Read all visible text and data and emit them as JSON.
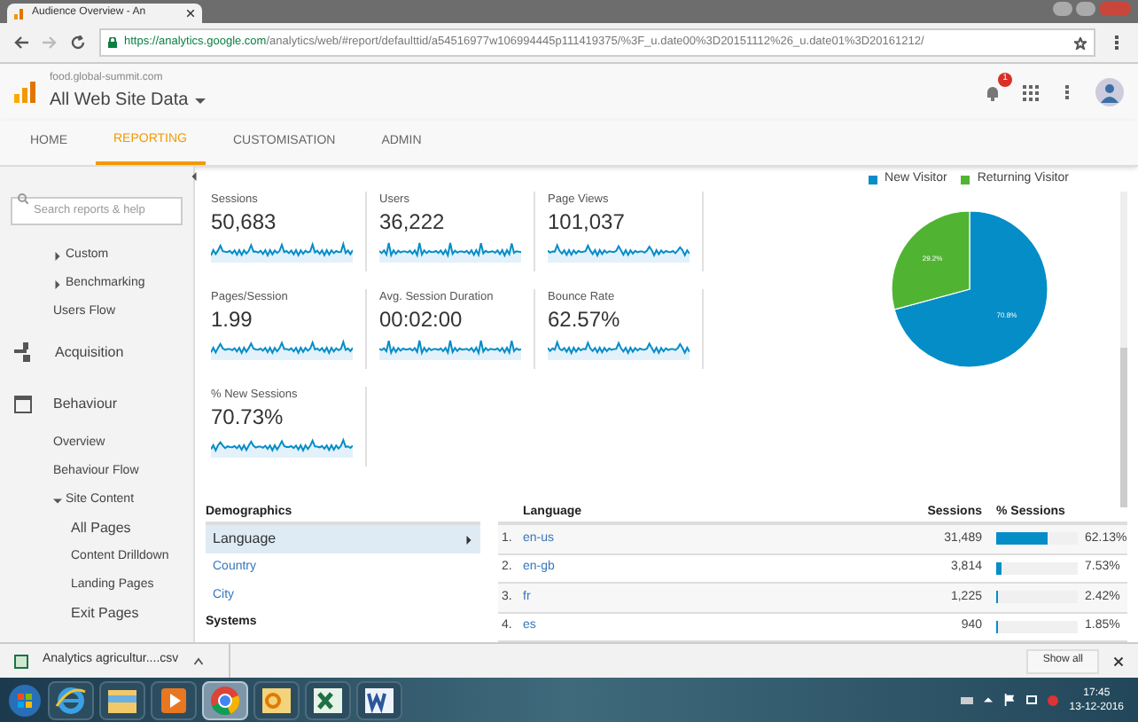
{
  "browser": {
    "tab_title": "Audience Overview - An",
    "url_host": "https://analytics.google.com",
    "url_path": "/analytics/web/#report/defaulttid/a54516977w106994445p111419375/%3F_u.date00%3D20151112%26_u.date01%3D20161212/"
  },
  "header": {
    "account": "food.global-summit.com",
    "property": "All Web Site Data",
    "notifications": "1"
  },
  "nav_tabs": [
    {
      "label": "HOME",
      "selected": false
    },
    {
      "label": "REPORTING",
      "selected": true
    },
    {
      "label": "CUSTOMISATION",
      "selected": false
    },
    {
      "label": "ADMIN",
      "selected": false
    }
  ],
  "sidebar": {
    "search_placeholder": "Search reports & help",
    "items": [
      {
        "label": "Custom",
        "kind": "collapsed"
      },
      {
        "label": "Benchmarking",
        "kind": "collapsed"
      },
      {
        "label": "Users Flow",
        "kind": "link"
      },
      {
        "label": "Acquisition",
        "kind": "section"
      },
      {
        "label": "Behaviour",
        "kind": "section",
        "children": [
          {
            "label": "Overview",
            "kind": "link"
          },
          {
            "label": "Behaviour Flow",
            "kind": "link"
          },
          {
            "label": "Site Content",
            "kind": "expanded",
            "children": [
              {
                "label": "All Pages",
                "kind": "link"
              },
              {
                "label": "Content Drilldown",
                "kind": "link"
              },
              {
                "label": "Landing Pages",
                "kind": "link"
              },
              {
                "label": "Exit Pages",
                "kind": "link"
              }
            ]
          }
        ]
      }
    ]
  },
  "scorecards": [
    {
      "label": "Sessions",
      "value": "50,683"
    },
    {
      "label": "Users",
      "value": "36,222"
    },
    {
      "label": "Page Views",
      "value": "101,037"
    },
    {
      "label": "Pages/Session",
      "value": "1.99"
    },
    {
      "label": "Avg. Session Duration",
      "value": "00:02:00"
    },
    {
      "label": "Bounce Rate",
      "value": "62.57%"
    },
    {
      "label": "% New Sessions",
      "value": "70.73%"
    }
  ],
  "visitor_chart": {
    "chart_data": {
      "type": "pie",
      "legend": true,
      "categories": [
        "New Visitor",
        "Returning Visitor"
      ],
      "values": [
        70.8,
        29.2
      ],
      "colors": [
        "#058dc7",
        "#50b432"
      ],
      "value_labels": [
        "70.8%",
        "29.2%"
      ]
    }
  },
  "demographics": {
    "title": "Demographics",
    "items": [
      {
        "label": "Language",
        "selected": true
      },
      {
        "label": "Country",
        "selected": false
      },
      {
        "label": "City",
        "selected": false
      }
    ],
    "next_title": "Systems"
  },
  "language_table": {
    "columns": [
      "Language",
      "Sessions",
      "% Sessions"
    ],
    "rows": [
      {
        "rank": "1.",
        "language": "en-us",
        "sessions": "31,489",
        "percent": "62.13%",
        "level": 0.6213
      },
      {
        "rank": "2.",
        "language": "en-gb",
        "sessions": "3,814",
        "percent": "7.53%",
        "level": 0.0753
      },
      {
        "rank": "3.",
        "language": "fr",
        "sessions": "1,225",
        "percent": "2.42%",
        "level": 0.0242
      },
      {
        "rank": "4.",
        "language": "es",
        "sessions": "940",
        "percent": "1.85%",
        "level": 0.0185
      }
    ]
  },
  "download_bar": {
    "file": "Analytics agricultur....csv",
    "button": "Show all"
  },
  "taskbar": {
    "apps": [
      {
        "kind": "ie",
        "selected": false
      },
      {
        "kind": "folder",
        "selected": false
      },
      {
        "kind": "media",
        "selected": false
      },
      {
        "kind": "chrome",
        "selected": true
      },
      {
        "kind": "outlook",
        "selected": false
      },
      {
        "kind": "excel",
        "selected": false
      },
      {
        "kind": "word",
        "selected": false
      }
    ],
    "time": "17:45",
    "date": "13-12-2016"
  }
}
